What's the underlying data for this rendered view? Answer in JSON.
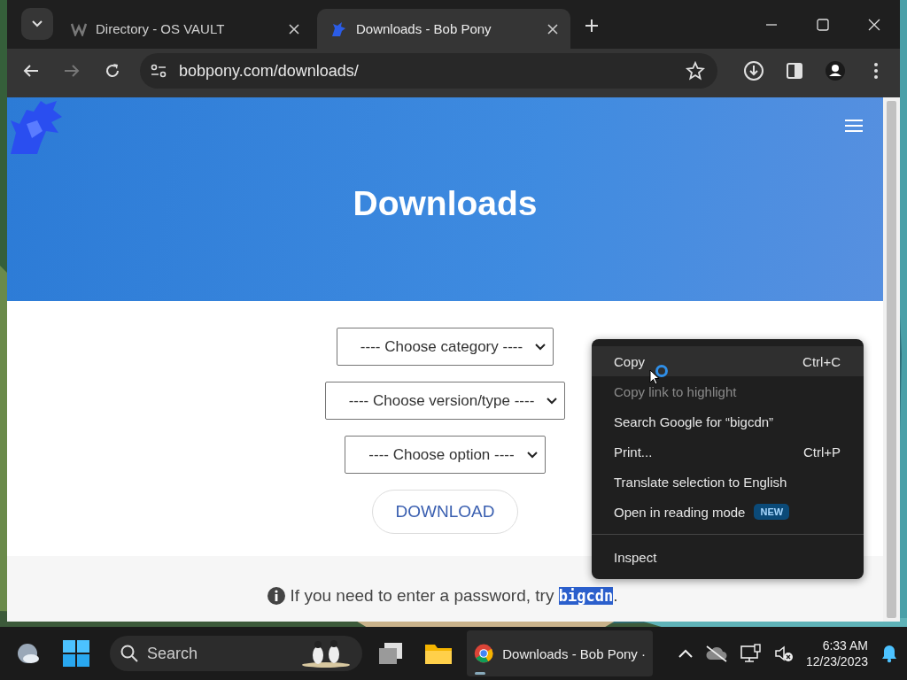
{
  "browser": {
    "tabs": [
      {
        "title": "Directory - OS VAULT",
        "selected": false
      },
      {
        "title": "Downloads - Bob Pony",
        "selected": true
      }
    ],
    "address": "bobpony.com/downloads/"
  },
  "page": {
    "title": "Downloads",
    "selects": [
      {
        "label": "---- Choose category ----"
      },
      {
        "label": "---- Choose version/type ----"
      },
      {
        "label": "---- Choose option ----"
      }
    ],
    "download_button": "DOWNLOAD",
    "note": {
      "text": "If you need to enter a password, try ",
      "password": "bigcdn",
      "password_selected": true,
      "end": "."
    }
  },
  "context_menu": {
    "groups": [
      [
        {
          "label": "Copy",
          "shortcut": "Ctrl+C",
          "hovered": true,
          "disabled": false
        },
        {
          "label": "Copy link to highlight",
          "hovered": false,
          "disabled": true
        },
        {
          "label": "Search Google for “bigcdn”",
          "hovered": false,
          "disabled": false
        },
        {
          "label": "Print...",
          "shortcut": "Ctrl+P",
          "hovered": false,
          "disabled": false
        },
        {
          "label": "Translate selection to English",
          "hovered": false,
          "disabled": false
        },
        {
          "label": "Open in reading mode",
          "badge": "NEW",
          "hovered": false,
          "disabled": false
        }
      ],
      [
        {
          "label": "Inspect",
          "hovered": false,
          "disabled": false
        }
      ]
    ]
  },
  "taskbar": {
    "search": "Search",
    "app": {
      "label": "Downloads - Bob Pony ·",
      "selected": true
    },
    "clock": {
      "time": "6:33 AM",
      "date": "12/23/2023"
    }
  }
}
